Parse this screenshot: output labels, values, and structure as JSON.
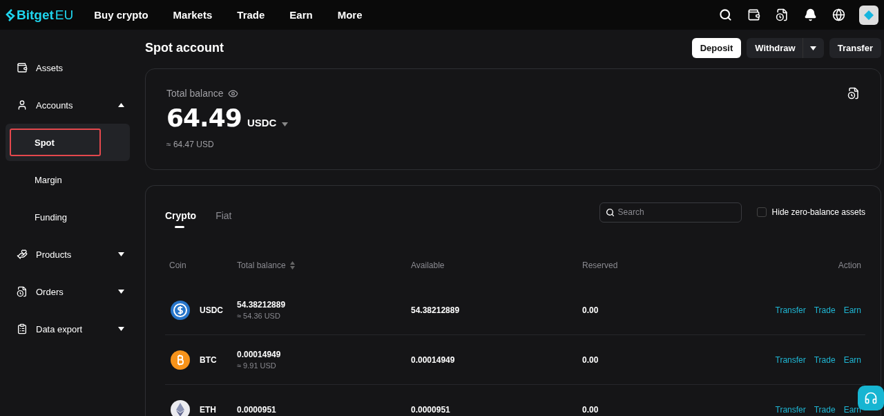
{
  "header": {
    "logo": "Bitget",
    "logo_suffix": "EU",
    "nav": [
      "Buy crypto",
      "Markets",
      "Trade",
      "Earn",
      "More"
    ]
  },
  "sidebar": {
    "items": [
      {
        "label": "Assets",
        "kind": "link"
      },
      {
        "label": "Accounts",
        "kind": "section",
        "expanded": true,
        "children": [
          {
            "label": "Spot",
            "selected": true
          },
          {
            "label": "Margin",
            "selected": false
          },
          {
            "label": "Funding",
            "selected": false
          }
        ]
      },
      {
        "label": "Products",
        "kind": "section",
        "expanded": false
      },
      {
        "label": "Orders",
        "kind": "section",
        "expanded": false
      },
      {
        "label": "Data export",
        "kind": "section",
        "expanded": false
      }
    ]
  },
  "page": {
    "title": "Spot account",
    "buttons": [
      {
        "label": "Deposit",
        "kind": "primary"
      },
      {
        "label": "Withdraw",
        "kind": "split"
      },
      {
        "label": "Transfer",
        "kind": "secondary"
      }
    ]
  },
  "balance": {
    "label": "Total balance",
    "amount": "64.49",
    "currency": "USDC",
    "approx": "≈ 64.47 USD"
  },
  "assets": {
    "tabs": [
      {
        "label": "Crypto",
        "selected": true
      },
      {
        "label": "Fiat",
        "selected": false
      }
    ],
    "search": {
      "placeholder": "Search"
    },
    "hide_zero": {
      "label": "Hide zero-balance assets",
      "checked": false
    },
    "columns": [
      "Coin",
      "Total balance",
      "Available",
      "Reserved",
      "Action"
    ],
    "rows": [
      {
        "coin": "USDC",
        "total": "54.38212889",
        "total_usd": "≈ 54.36 USD",
        "available": "54.38212889",
        "reserved": "0.00",
        "actions": [
          "Transfer",
          "Trade",
          "Earn"
        ]
      },
      {
        "coin": "BTC",
        "total": "0.00014949",
        "total_usd": "≈ 9.91 USD",
        "available": "0.00014949",
        "reserved": "0.00",
        "actions": [
          "Transfer",
          "Trade",
          "Earn"
        ]
      },
      {
        "coin": "ETH",
        "total": "0.0000951",
        "available": "0.0000951",
        "reserved": "0.00",
        "actions": [
          "Transfer",
          "Trade",
          "Earn"
        ]
      }
    ]
  }
}
